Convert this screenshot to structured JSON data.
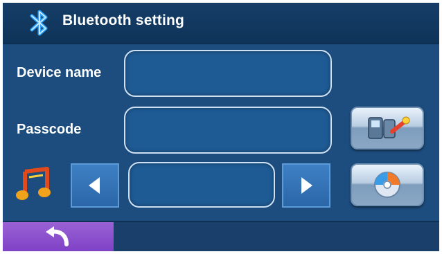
{
  "header": {
    "title": "Bluetooth setting",
    "icon": "bluetooth-icon"
  },
  "form": {
    "device_name_label": "Device name",
    "device_name_value": "",
    "passcode_label": "Passcode",
    "passcode_value": "",
    "selector_value": ""
  },
  "icons": {
    "music": "music-note-icon",
    "prev": "left-arrow-icon",
    "next": "right-arrow-icon",
    "connect": "phone-pair-icon",
    "disc": "disc-icon",
    "back": "back-arrow-icon"
  },
  "colors": {
    "background": "#1c4d7e",
    "title_bar": "#153d67",
    "back_button": "#8a4fd0",
    "field_border": "#cfe0f2"
  }
}
